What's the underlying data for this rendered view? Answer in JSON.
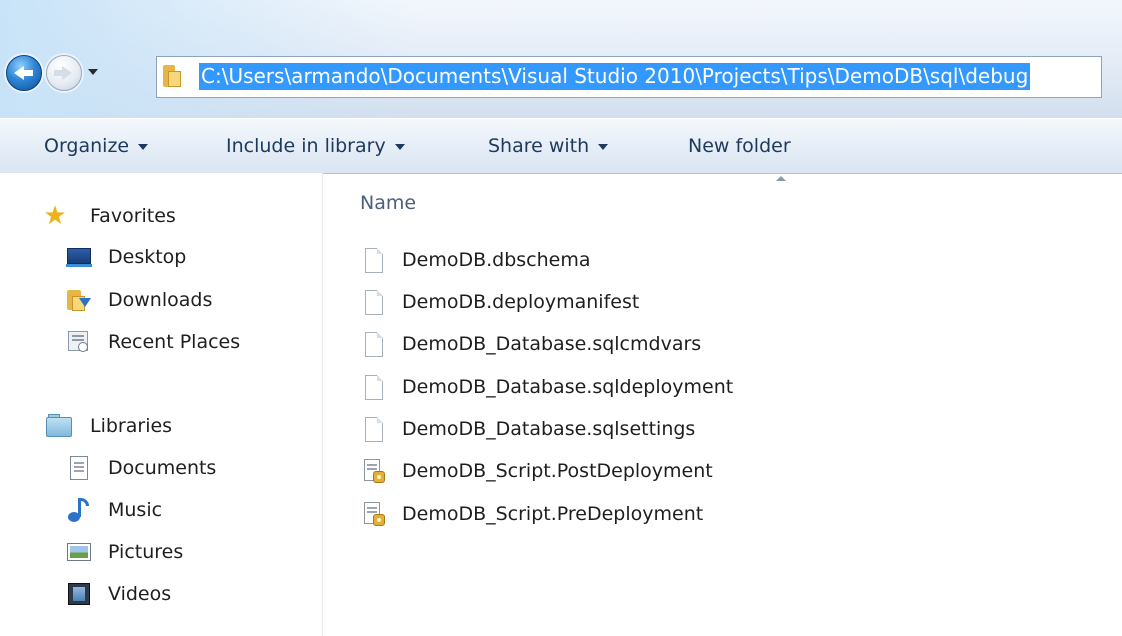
{
  "address_bar": {
    "path": "C:\\Users\\armando\\Documents\\Visual Studio 2010\\Projects\\Tips\\DemoDB\\sql\\debug"
  },
  "command_bar": {
    "organize": "Organize",
    "include_in_library": "Include in library",
    "share_with": "Share with",
    "new_folder": "New folder"
  },
  "navigation": {
    "favorites": {
      "label": "Favorites",
      "items": [
        "Desktop",
        "Downloads",
        "Recent Places"
      ]
    },
    "libraries": {
      "label": "Libraries",
      "items": [
        "Documents",
        "Music",
        "Pictures",
        "Videos"
      ]
    }
  },
  "file_list": {
    "column_header": "Name",
    "files": [
      "DemoDB.dbschema",
      "DemoDB.deploymanifest",
      "DemoDB_Database.sqlcmdvars",
      "DemoDB_Database.sqldeployment",
      "DemoDB_Database.sqlsettings",
      "DemoDB_Script.PostDeployment",
      "DemoDB_Script.PreDeployment"
    ]
  }
}
